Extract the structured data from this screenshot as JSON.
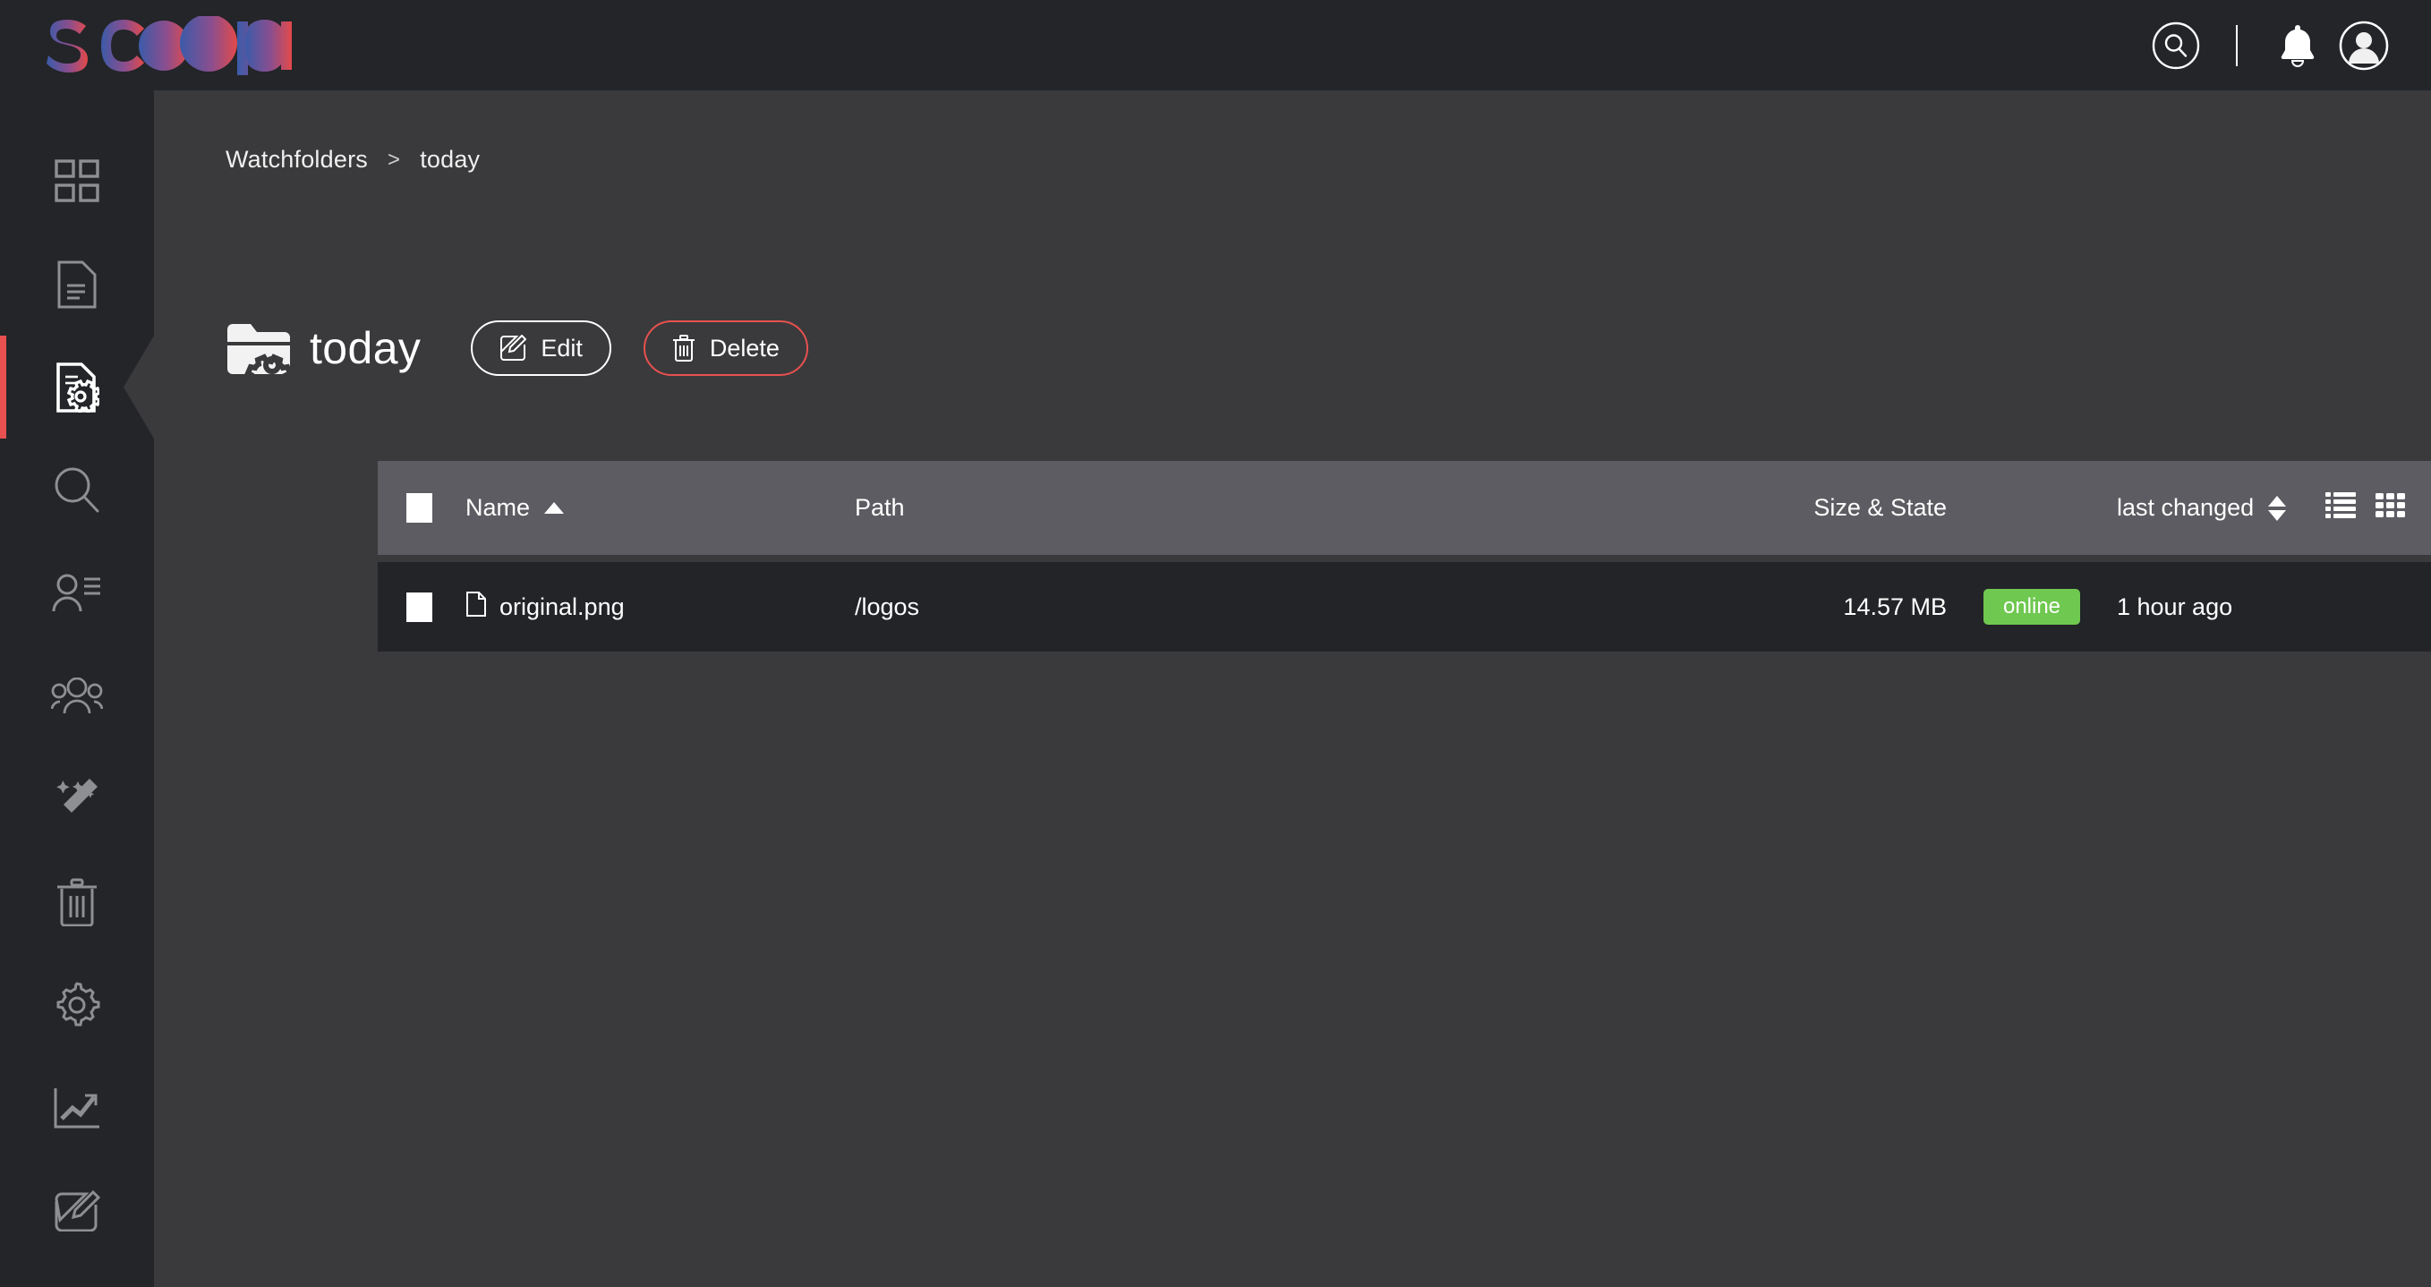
{
  "brand": {
    "name": "scoopa",
    "color_start": "#3b5ba9",
    "color_end": "#e34a4a"
  },
  "topbar": {
    "search_icon": "search-circle-icon",
    "notifications_icon": "bell-icon",
    "account_icon": "user-avatar-icon"
  },
  "sidebar": {
    "items": [
      {
        "icon": "dashboard-grid-icon",
        "name": "dashboard",
        "active": false
      },
      {
        "icon": "document-icon",
        "name": "documents",
        "active": false
      },
      {
        "icon": "document-gear-icon",
        "name": "watchfolders",
        "active": true
      },
      {
        "icon": "magnifier-icon",
        "name": "search",
        "active": false
      },
      {
        "icon": "user-details-icon",
        "name": "user-details",
        "active": false
      },
      {
        "icon": "users-group-icon",
        "name": "groups",
        "active": false
      },
      {
        "icon": "magic-wand-icon",
        "name": "automation",
        "active": false
      },
      {
        "icon": "trash-icon",
        "name": "trash",
        "active": false
      },
      {
        "icon": "gear-icon",
        "name": "settings",
        "active": false
      },
      {
        "icon": "trending-up-icon",
        "name": "statistics",
        "active": false
      },
      {
        "icon": "edit-square-icon",
        "name": "editor",
        "active": false
      }
    ],
    "active_accent": "#e8514f"
  },
  "breadcrumb": {
    "root": "Watchfolders",
    "separator": ">",
    "current": "today"
  },
  "header": {
    "title": "today",
    "folder_icon": "folder-gear-icon",
    "edit_label": "Edit",
    "edit_icon": "pencil-square-icon",
    "delete_label": "Delete",
    "delete_icon": "trash-icon",
    "delete_color": "#e8514f"
  },
  "table": {
    "columns": {
      "name": "Name",
      "path": "Path",
      "size_state": "Size & State",
      "last_changed": "last changed"
    },
    "sort": {
      "name": "asc",
      "last_changed": "none"
    },
    "views": {
      "list_icon": "list-view-icon",
      "grid_icon": "grid-view-icon",
      "active": "list"
    },
    "rows": [
      {
        "checked": false,
        "file_icon": "file-icon",
        "name": "original.png",
        "path": "/logos",
        "size": "14.57 MB",
        "state": "online",
        "state_color": "#6fc850",
        "last_changed": "1 hour ago"
      }
    ]
  }
}
